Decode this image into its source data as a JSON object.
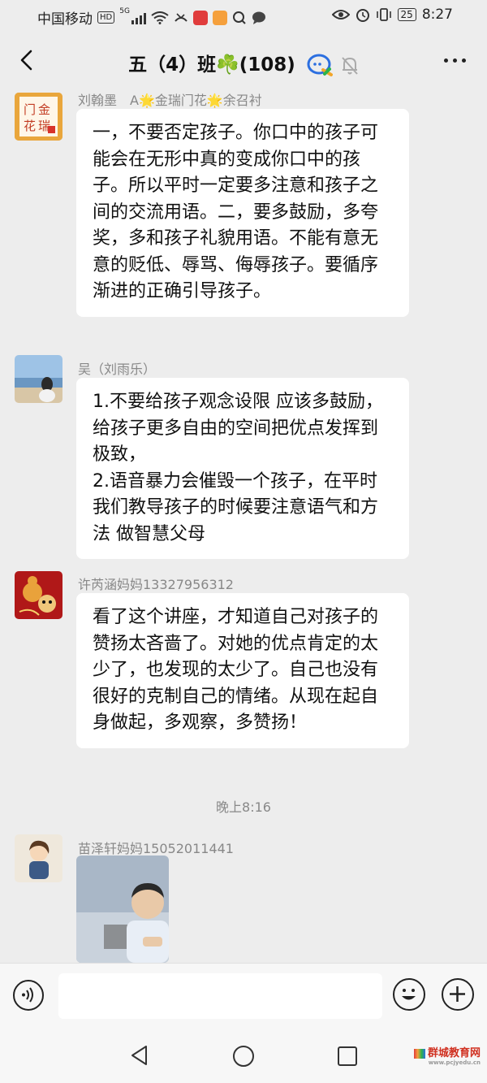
{
  "status_bar": {
    "carrier": "中国移动",
    "hd": "HD",
    "network": "5G",
    "battery": "25",
    "time": "8:27"
  },
  "header": {
    "title": "五（4）班☘️(108)"
  },
  "messages": [
    {
      "sender": "刘翰墨　A🌟金瑞门花🌟余召衬",
      "avatar_icon": "calligraphy-avatar",
      "text": "一，不要否定孩子。你口中的孩子可能会在无形中真的变成你口中的孩子。所以平时一定要多注意和孩子之间的交流用语。二，要多鼓励，多夸奖，多和孩子礼貌用语。不能有意无意的贬低、辱骂、侮辱孩子。要循序渐进的正确引导孩子。"
    },
    {
      "sender": "吴（刘雨乐）",
      "avatar_icon": "beach-avatar",
      "text": "1.不要给孩子观念设限 应该多鼓励，给孩子更多自由的空间把优点发挥到极致，\n2.语音暴力会催毁一个孩子，在平时我们教导孩子的时候要注意语气和方法 做智慧父母"
    },
    {
      "sender": "许芮涵妈妈13327956312",
      "avatar_icon": "gourd-avatar",
      "text": "看了这个讲座，才知道自己对孩子的赞扬太吝啬了。对她的优点肯定的太少了，也发现的太少了。自己也没有很好的克制自己的情绪。从现在起自身做起，多观察，多赞扬！"
    }
  ],
  "time_divider": "晚上8:16",
  "image_message": {
    "sender": "苗泽轩妈妈15052011441",
    "avatar_icon": "cartoon-girl-avatar",
    "image_icon": "child-photo"
  },
  "watermark": {
    "text": "群城教育网",
    "sub": "www.pcjyedu.cn"
  },
  "colors": {
    "background": "#ededed",
    "bubble": "#ffffff",
    "sender_text": "#888888"
  }
}
